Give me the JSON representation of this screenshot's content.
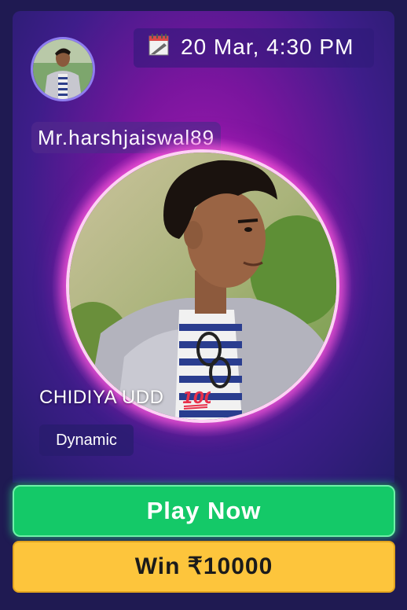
{
  "card": {
    "date_time": "20 Mar, 4:30 PM",
    "username": "Mr.harshjaiswal89",
    "game_title": "CHIDIYA UDD",
    "game_type": "Dynamic"
  },
  "actions": {
    "play_label": "Play Now",
    "win_label": "Win ₹10000"
  },
  "icons": {
    "calendar": "calendar-icon",
    "emoji": "hundred-points-emoji",
    "avatar": "user-avatar",
    "photo": "profile-photo"
  },
  "colors": {
    "background": "#1f1a52",
    "card_glow": "#a01bb0",
    "ring": "#ff5adc",
    "play_button": "#14c968",
    "win_button": "#fdc53c"
  }
}
